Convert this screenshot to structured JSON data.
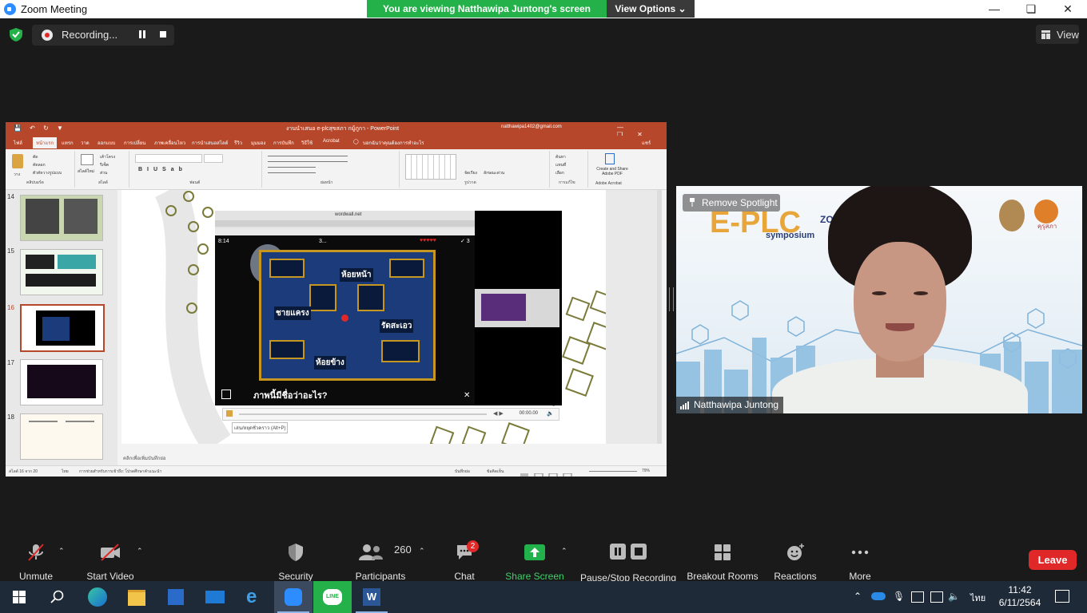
{
  "window": {
    "title": "Zoom Meeting"
  },
  "banner": {
    "viewing": "You are viewing Natthawipa Juntong's screen",
    "view_options": "View Options"
  },
  "recording": {
    "label": "Recording..."
  },
  "view_button": {
    "label": "View"
  },
  "shared": {
    "ppt_title": "งานนำเสนอ e-plcสุขสภา กมู้ภูกา - PowerPoint",
    "ppt_account": "natthawipa1402@gmail.com",
    "tabs": [
      "ไฟล์",
      "หน้าแรก",
      "แทรก",
      "วาด",
      "ออกแบบ",
      "การเปลี่ยน",
      "ภาพเคลื่อนไหว",
      "การนำเสนอสไลด์",
      "รีวิว",
      "มุมมอง",
      "การบันทึก",
      "วิธีใช้",
      "Acrobat",
      "บอกฉันว่าคุณต้องการทำอะไร",
      "แชร์"
    ],
    "ribbon_groups": [
      "คลิปบอร์ด",
      "สไลด์",
      "ฟอนต์",
      "ย่อหน้า",
      "รูปวาด",
      "การแก้ไข",
      "Adobe Acrobat"
    ],
    "ribbon_items": {
      "paste": "วาง",
      "cut": "ตัด",
      "copy": "คัดลอก",
      "format_painter": "ตัวคัดวางรูปแบบ",
      "new_slide": "สไลด์ใหม่",
      "layout": "เค้าโครง",
      "reset": "รีเซ็ต",
      "section": "ส่วน",
      "find": "ค้นหา",
      "replace": "แทนที่",
      "select": "เลือก",
      "arrange": "จัดเรียง",
      "quick_styles": "ลักษณะด่วน",
      "create_share_pdf": "Create and Share Adobe PDF"
    },
    "slide_numbers": [
      "14",
      "15",
      "16",
      "17",
      "18"
    ],
    "game": {
      "url": "wordwall.net",
      "time": "8:14",
      "score": "3...",
      "lives": "♥♥♥♥♥",
      "correct": "✓ 3",
      "labels": [
        "ห้อยหน้า",
        "ชายแครง",
        "รัดสะเอว",
        "ห้อยข้าง"
      ],
      "question": "ภาพนี้มีชื่อว่าอะไร?"
    },
    "media_time": "00:00.00",
    "media_tip": "เล่น/หยุดชั่วคราว (Alt+P)",
    "notes_placeholder": "คลิกเพื่อเพิ่มบันทึกย่อ",
    "status_slide": "สไลด์ 16 จาก 20",
    "status_lang": "ไทย",
    "status_access": "การช่วยสำหรับการเข้าถึง: โปรดศึกษาคำแนะนำ",
    "status_notes": "บันทึกย่อ",
    "status_comments": "ข้อคิดเห็น",
    "zoom_pct": "79%"
  },
  "video": {
    "remove_spotlight": "Remove Spotlight",
    "participant_name": "Natthawipa Juntong",
    "bg_title": "E-PLC",
    "bg_sub": "symposium",
    "bg_zoom": "ZOO",
    "logo_text": "คุรุสภา"
  },
  "toolbar": {
    "unmute": "Unmute",
    "start_video": "Start Video",
    "security": "Security",
    "participants_count": "260",
    "participants": "Participants",
    "chat": "Chat",
    "chat_badge": "2",
    "share_screen": "Share Screen",
    "pause_stop_recording": "Pause/Stop Recording",
    "breakout_rooms": "Breakout Rooms",
    "reactions": "Reactions",
    "more": "More",
    "leave": "Leave"
  },
  "taskbar": {
    "time": "11:42",
    "date": "6/11/2564",
    "lang": "ไทย"
  },
  "colors": {
    "zoom_blue": "#2D8CFF",
    "banner_green": "#24b14a",
    "leave_red": "#e02828",
    "ppt_red": "#b7472a",
    "share_green": "#22b24c"
  }
}
